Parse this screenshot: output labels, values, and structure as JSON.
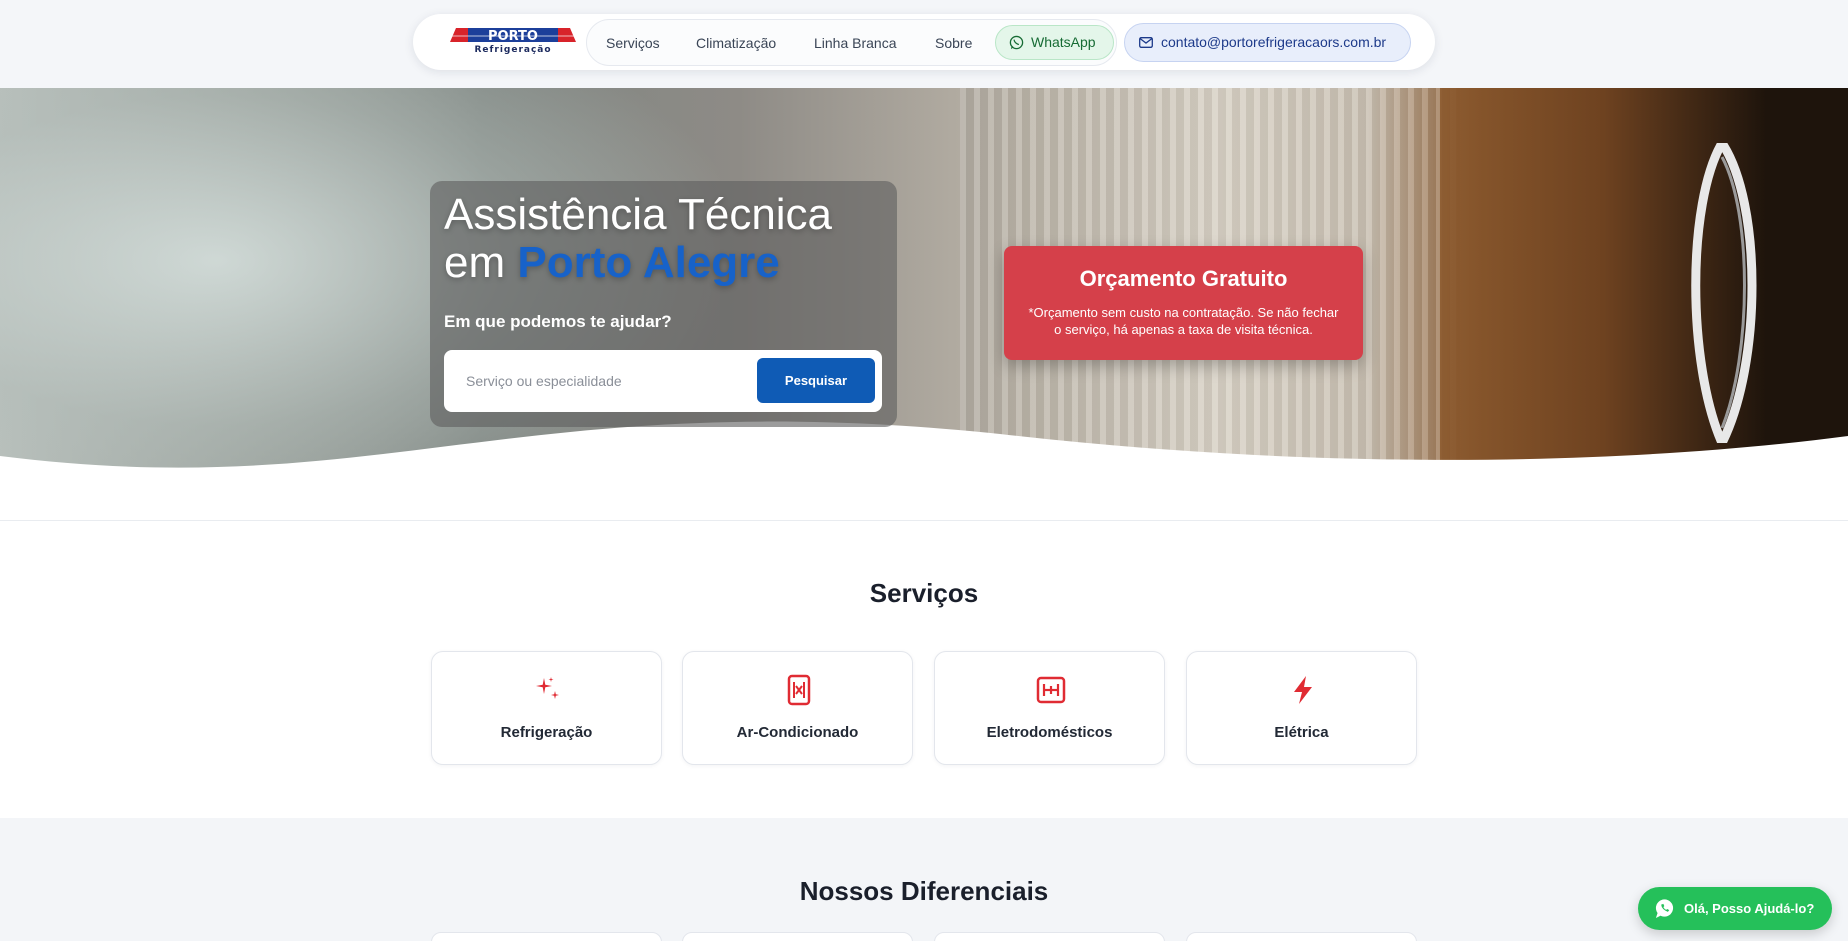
{
  "brand": {
    "logo_text": "PORTO",
    "logo_subtext": "Refrigeração",
    "colors": {
      "red": "#d8232a",
      "blue": "#1c3f9a",
      "navy": "#1c2a5e"
    }
  },
  "nav": {
    "items": [
      {
        "label": "Serviços"
      },
      {
        "label": "Climatização"
      },
      {
        "label": "Linha Branca"
      },
      {
        "label": "Sobre"
      }
    ],
    "whatsapp_label": "WhatsApp",
    "email_label": "contato@portorefrigeracaors.com.br"
  },
  "hero": {
    "title_line1": "Assistência Técnica",
    "title_prefix": "em ",
    "title_accent": "Porto Alegre",
    "question": "Em que podemos te ajudar?",
    "search_placeholder": "Serviço ou especialidade",
    "search_button": "Pesquisar",
    "accent_color": "#1762c9"
  },
  "quote": {
    "title": "Orçamento Gratuito",
    "note": "*Orçamento sem custo na contratação. Se não fechar o serviço, há apenas a taxa de visita técnica.",
    "color": "#d5404a"
  },
  "services": {
    "title": "Serviços",
    "items": [
      {
        "label": "Refrigeração",
        "icon": "sparkles-icon"
      },
      {
        "label": "Ar-Condicionado",
        "icon": "air-conditioner-icon"
      },
      {
        "label": "Eletrodomésticos",
        "icon": "appliance-icon"
      },
      {
        "label": "Elétrica",
        "icon": "lightning-icon"
      }
    ],
    "icon_color": "#e02b33"
  },
  "differentials": {
    "title": "Nossos Diferenciais"
  },
  "chat": {
    "label": "Olá, Posso Ajudá-lo?",
    "color": "#25c05a"
  }
}
